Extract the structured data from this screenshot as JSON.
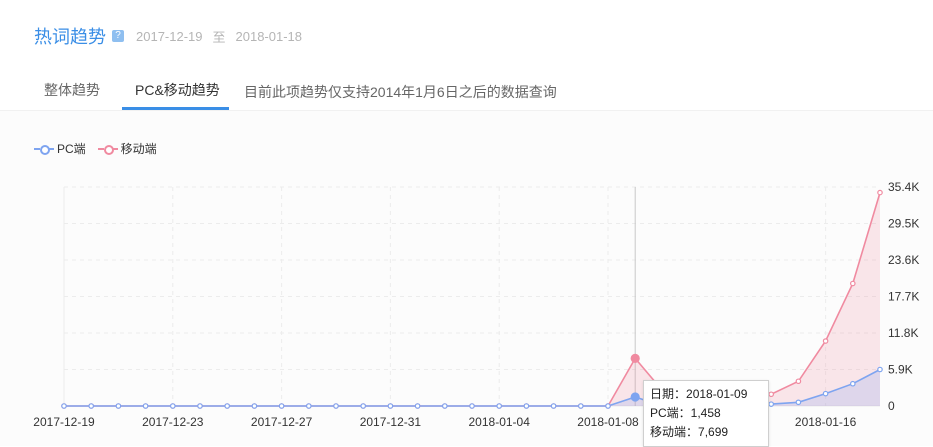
{
  "header": {
    "title": "热词趋势",
    "help_icon": "?",
    "date_from": "2017-12-19",
    "separator": "至",
    "date_to": "2018-01-18"
  },
  "tabs": [
    {
      "label": "整体趋势",
      "active": false
    },
    {
      "label": "PC&移动趋势",
      "active": true
    }
  ],
  "note": "目前此项趋势仅支持2014年1月6日之后的数据查询",
  "colors": {
    "accent": "#3a8ee6",
    "pc": "#7ea4f0",
    "mobile": "#f08aa0"
  },
  "chart_data": {
    "type": "line",
    "x": [
      "2017-12-19",
      "2017-12-20",
      "2017-12-21",
      "2017-12-22",
      "2017-12-23",
      "2017-12-24",
      "2017-12-25",
      "2017-12-26",
      "2017-12-27",
      "2017-12-28",
      "2017-12-29",
      "2017-12-30",
      "2017-12-31",
      "2018-01-01",
      "2018-01-02",
      "2018-01-03",
      "2018-01-04",
      "2018-01-05",
      "2018-01-06",
      "2018-01-07",
      "2018-01-08",
      "2018-01-09",
      "2018-01-10",
      "2018-01-11",
      "2018-01-12",
      "2018-01-13",
      "2018-01-14",
      "2018-01-15",
      "2018-01-16",
      "2018-01-17",
      "2018-01-18"
    ],
    "x_tick_labels": [
      "2017-12-19",
      "2017-12-23",
      "2017-12-27",
      "2017-12-31",
      "2018-01-04",
      "2018-01-08",
      "2018-01-16"
    ],
    "y_tick_labels": [
      "0",
      "5.9K",
      "11.8K",
      "17.7K",
      "23.6K",
      "29.5K",
      "35.4K"
    ],
    "ylim": [
      0,
      35400
    ],
    "area": true,
    "grid": true,
    "legend": "top-left",
    "series": [
      {
        "name": "PC端",
        "color": "#7ea4f0",
        "values": [
          0,
          0,
          0,
          0,
          0,
          0,
          0,
          0,
          0,
          0,
          0,
          0,
          0,
          0,
          0,
          0,
          0,
          0,
          0,
          0,
          0,
          1458,
          0,
          100,
          150,
          200,
          300,
          600,
          2000,
          3600,
          5900
        ]
      },
      {
        "name": "移动端",
        "color": "#f08aa0",
        "values": [
          0,
          0,
          0,
          0,
          0,
          0,
          0,
          0,
          0,
          0,
          0,
          0,
          0,
          0,
          0,
          0,
          0,
          0,
          0,
          0,
          0,
          7699,
          2500,
          1800,
          1600,
          1700,
          1900,
          4000,
          10500,
          19800,
          34500
        ]
      }
    ],
    "tooltip": {
      "date_label": "日期：",
      "date": "2018-01-09",
      "pc_label": "PC端：",
      "pc_value": "1,458",
      "mobile_label": "移动端：",
      "mobile_value": "7,699"
    }
  }
}
